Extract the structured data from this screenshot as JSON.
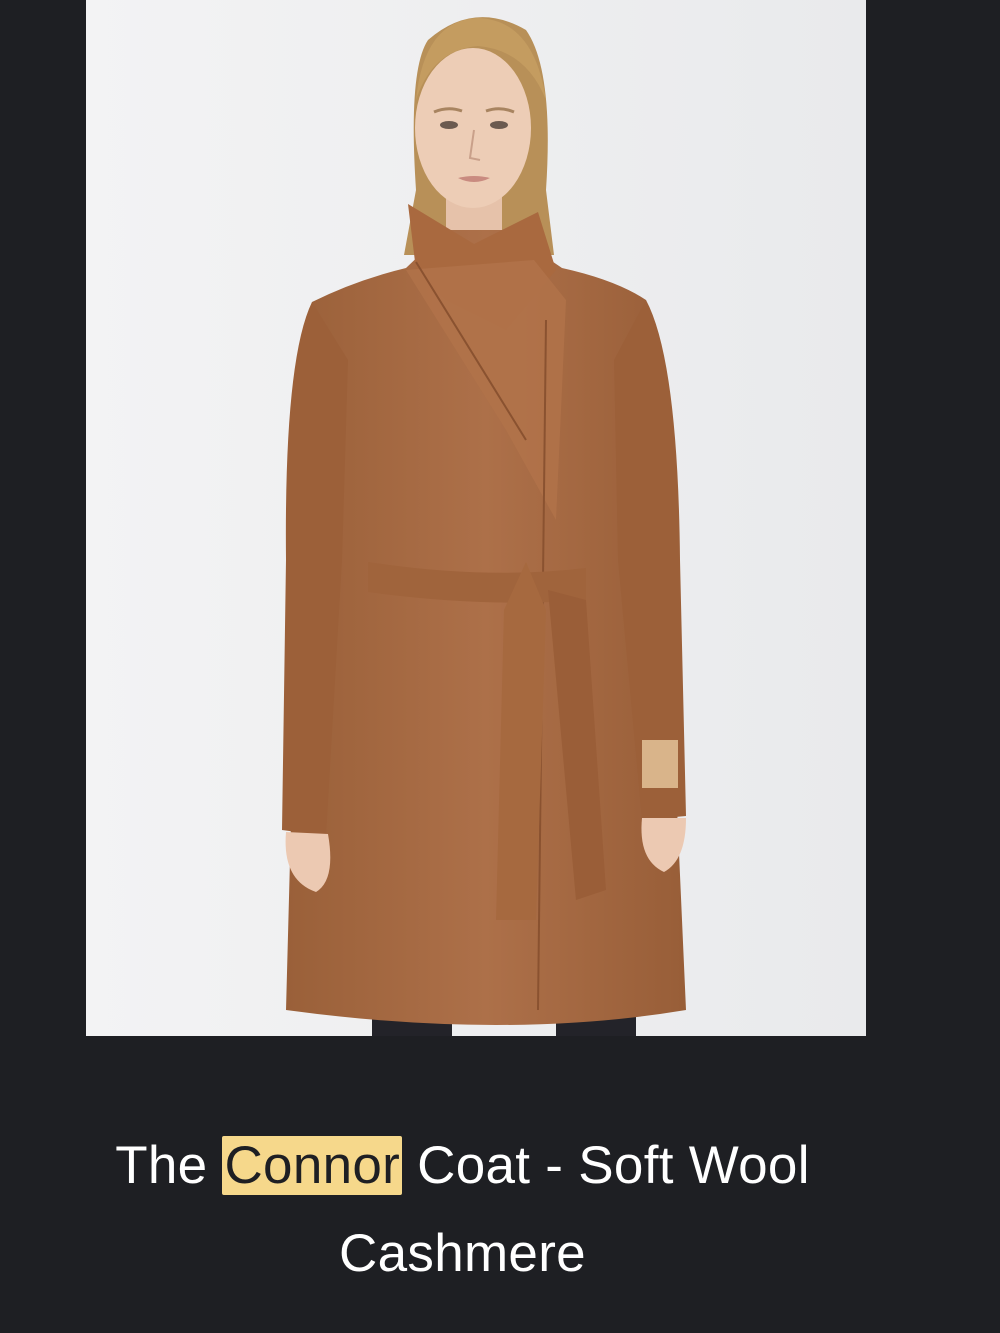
{
  "product": {
    "title_before": "The ",
    "title_highlight": "Connor",
    "title_after": " Coat - Soft Wool",
    "title_line2": "Cashmere"
  },
  "colors": {
    "background": "#1e1f23",
    "photo_background": "#eeeff1",
    "coat": "#a86b44",
    "highlight": "#f6d88b",
    "text": "#ffffff"
  },
  "image": {
    "subject": "model-wearing-camel-wrap-coat"
  }
}
